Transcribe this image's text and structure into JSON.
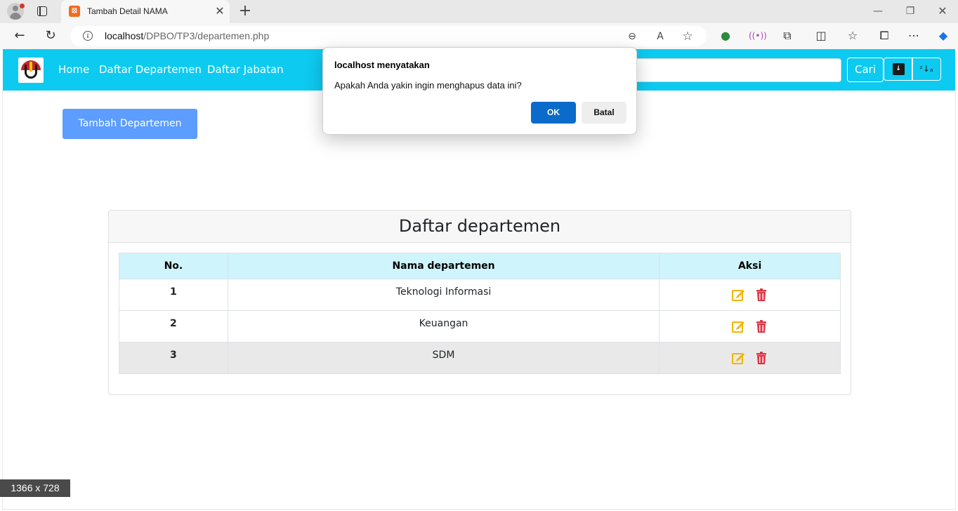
{
  "browser": {
    "tab_title": "Tambah Detail NAMA",
    "tab_favicon": "xampp-icon",
    "url_host": "localhost",
    "url_path": "/DPBO/TP3/departemen.php"
  },
  "navbar": {
    "links": [
      "Home",
      "Daftar Departemen",
      "Daftar Jabatan"
    ],
    "search_placeholder": "",
    "search_button": "Cari",
    "sort_asc_label": "A Z",
    "sort_desc_label": "Z A",
    "colors": {
      "navbar_bg": "#0dcaf0"
    }
  },
  "main": {
    "add_button": "Tambah Departemen",
    "card_title": "Daftar departemen",
    "table": {
      "headers": [
        "No.",
        "Nama departemen",
        "Aksi"
      ],
      "rows": [
        {
          "no": "1",
          "name": "Teknologi Informasi"
        },
        {
          "no": "2",
          "name": "Keuangan"
        },
        {
          "no": "3",
          "name": "SDM"
        }
      ],
      "action_icons": [
        "edit-icon",
        "trash-icon"
      ]
    }
  },
  "dialog": {
    "title": "localhost menyatakan",
    "message": "Apakah Anda yakin ingin menghapus data ini?",
    "ok": "OK",
    "cancel": "Batal"
  },
  "overlay": {
    "size_badge": "1366 x 728"
  }
}
